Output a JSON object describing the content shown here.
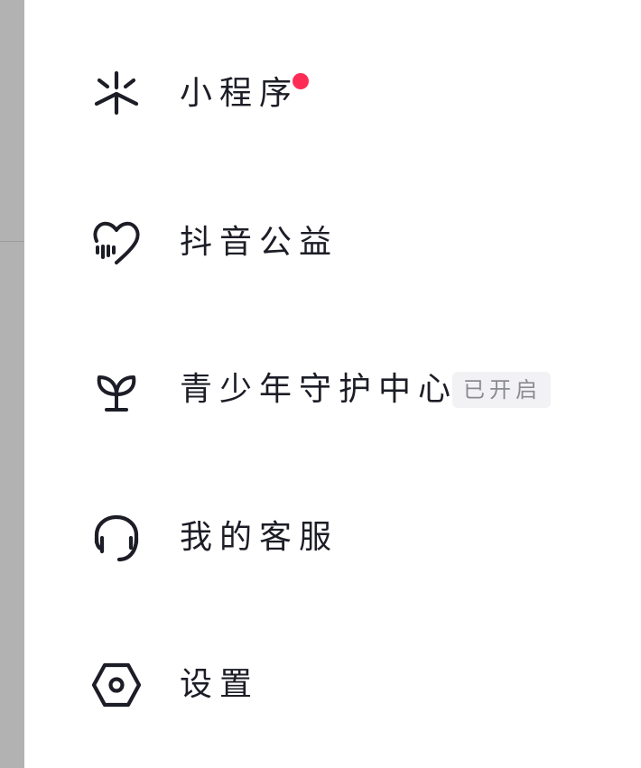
{
  "menu": {
    "items": [
      {
        "id": "mini-programs",
        "label": "小程序",
        "icon": "mini-program-icon",
        "has_red_dot": true
      },
      {
        "id": "charity",
        "label": "抖音公益",
        "icon": "charity-heart-icon"
      },
      {
        "id": "youth-protection",
        "label": "青少年守护中心",
        "icon": "sprout-icon",
        "badge": "已开启"
      },
      {
        "id": "customer-service",
        "label": "我的客服",
        "icon": "headset-icon"
      },
      {
        "id": "settings",
        "label": "设置",
        "icon": "hexagon-settings-icon"
      }
    ]
  },
  "colors": {
    "text": "#1c1d26",
    "red_dot": "#fe2c55",
    "badge_bg": "#f2f2f4",
    "badge_text": "#8a8b91",
    "left_strip": "#b2b2b2"
  }
}
